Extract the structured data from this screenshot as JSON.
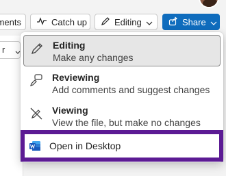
{
  "toolbar": {
    "comments_label": "ments",
    "catchup_label": "Catch up",
    "mode_label": "Editing",
    "share_label": "Share"
  },
  "side": {
    "select_value": "r"
  },
  "menu": {
    "items": [
      {
        "title": "Editing",
        "description": "Make any changes",
        "icon": "pencil-icon"
      },
      {
        "title": "Reviewing",
        "description": "Add comments and suggest changes",
        "icon": "review-icon"
      },
      {
        "title": "Viewing",
        "description": "View the file, but make no changes",
        "icon": "no-edit-icon"
      }
    ],
    "open_desktop_label": "Open in Desktop"
  },
  "colors": {
    "accent": "#0f6cbd",
    "highlight_frame": "#5c1b94",
    "word_blue": "#185abd"
  }
}
